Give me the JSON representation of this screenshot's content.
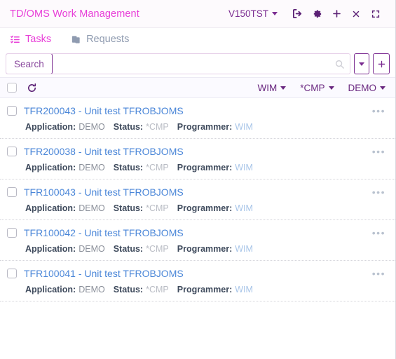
{
  "titlebar": {
    "title": "TD/OMS Work Management",
    "environment": "V150TST",
    "icons": [
      "logout-icon",
      "gear-icon",
      "plus-icon",
      "close-icon",
      "expand-icon"
    ]
  },
  "tabs": [
    {
      "label": "Tasks",
      "icon": "list-check-icon",
      "active": true
    },
    {
      "label": "Requests",
      "icon": "clipboard-copy-icon",
      "active": false
    }
  ],
  "search": {
    "button_label": "Search",
    "placeholder": "",
    "value": "",
    "magnifier_icon": "search-icon",
    "dropdown_icon": "caret-down-icon",
    "add_icon": "plus-icon"
  },
  "filterbar": {
    "select_all": false,
    "refresh_icon": "refresh-icon",
    "filters": [
      {
        "label": "WIM"
      },
      {
        "label": "*CMP"
      },
      {
        "label": "DEMO"
      }
    ]
  },
  "list": {
    "meta_labels": {
      "application": "Application:",
      "status": "Status:",
      "programmer": "Programmer:"
    },
    "menu_glyph": "•••",
    "rows": [
      {
        "title": "TFR200043 - Unit test TFROBJOMS",
        "application": "DEMO",
        "status": "*CMP",
        "programmer": "WIM",
        "checked": false
      },
      {
        "title": "TFR200038 - Unit test TFROBJOMS",
        "application": "DEMO",
        "status": "*CMP",
        "programmer": "WIM",
        "checked": false
      },
      {
        "title": "TFR100043 - Unit test TFROBJOMS",
        "application": "DEMO",
        "status": "*CMP",
        "programmer": "WIM",
        "checked": false
      },
      {
        "title": "TFR100042 - Unit test TFROBJOMS",
        "application": "DEMO",
        "status": "*CMP",
        "programmer": "WIM",
        "checked": false
      },
      {
        "title": "TFR100041 - Unit test TFROBJOMS",
        "application": "DEMO",
        "status": "*CMP",
        "programmer": "WIM",
        "checked": false
      }
    ]
  },
  "colors": {
    "brand_magenta": "#e83fd8",
    "purple": "#7b2c91",
    "link_blue": "#4a86d8",
    "muted_gray": "#8a8f99"
  }
}
